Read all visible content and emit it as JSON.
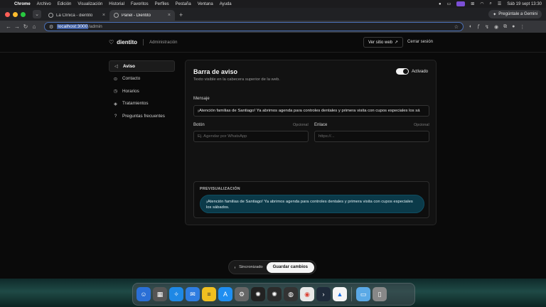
{
  "menubar": {
    "app": "Chrome",
    "items": [
      "Archivo",
      "Edición",
      "Visualización",
      "Historial",
      "Favoritos",
      "Perfiles",
      "Pestaña",
      "Ventana",
      "Ayuda"
    ],
    "clock": "Sáb 19 sept  13:30"
  },
  "browser": {
    "tabs": [
      {
        "title": "La Clínica - dientito",
        "active": false
      },
      {
        "title": "Panel - Dientito",
        "active": true
      }
    ],
    "gemini_label": "Pregúntale a Gemini",
    "url_host": "localhost:3000",
    "url_path": "/admin"
  },
  "header": {
    "brand": "dientito",
    "section": "Administración",
    "site_button": "Ver sitio web",
    "logout": "Cerrar sesión"
  },
  "sidebar": {
    "items": [
      {
        "label": "Aviso",
        "icon": "megaphone-icon",
        "active": true
      },
      {
        "label": "Contacto",
        "icon": "location-pin-icon",
        "active": false
      },
      {
        "label": "Horarios",
        "icon": "clock-icon",
        "active": false
      },
      {
        "label": "Tratamientos",
        "icon": "layers-icon",
        "active": false
      },
      {
        "label": "Preguntas frecuentes",
        "icon": "help-circle-icon",
        "active": false
      }
    ]
  },
  "card": {
    "title": "Barra de aviso",
    "description": "Texto visible en la cabecera superior de la web.",
    "toggle_label": "Activado",
    "toggle_on": true,
    "message_label": "Mensaje",
    "message_value": "¡Atención familias de Santiago! Ya abrimos agenda para controles dentales y primera visita con cupos especiales los sá",
    "button_label": "Botón",
    "button_optional": "Opcional",
    "button_placeholder": "Ej. Agendar por WhatsApp",
    "link_label": "Enlace",
    "link_optional": "Opcional",
    "link_placeholder": "https://...",
    "preview_title": "PREVISUALIZACIÓN",
    "preview_text": "¡Atención familias de Santiago! Ya abrimos agenda para controles dentales y primera visita con cupos especiales los sábados."
  },
  "savebar": {
    "status": "Sincronizado",
    "save_label": "Guardar cambios"
  },
  "colors": {
    "accent_preview": "#0b3a49",
    "page_bg": "#0a0a0a"
  }
}
